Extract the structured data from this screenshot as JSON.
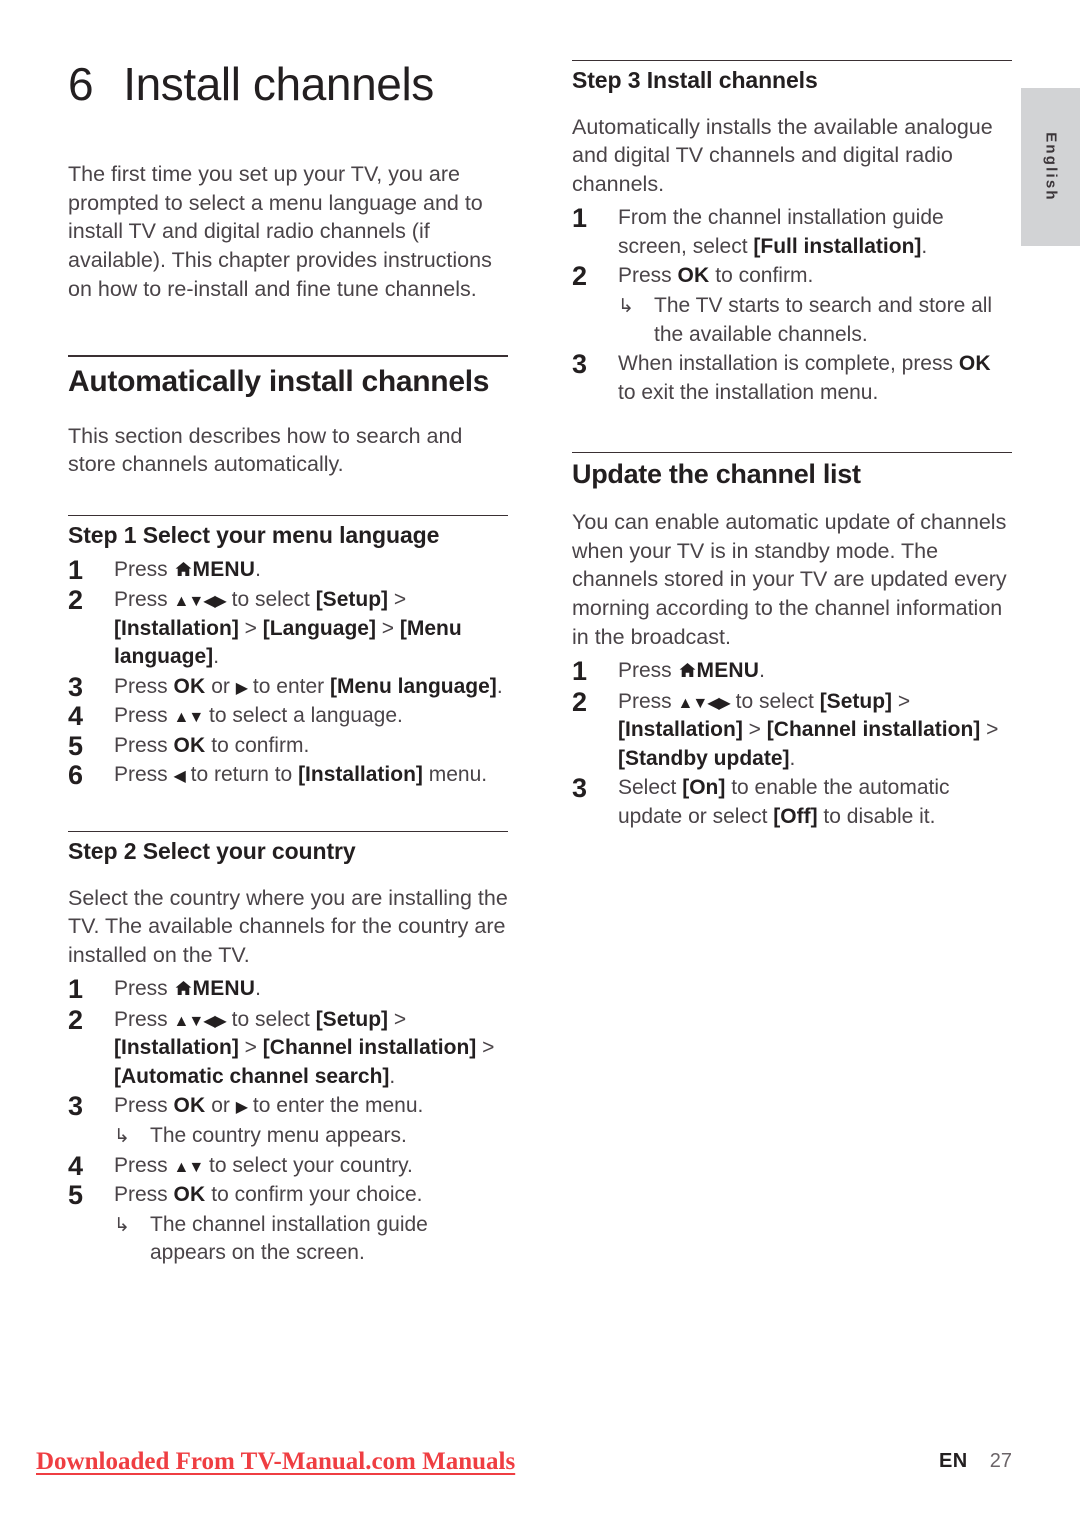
{
  "side_tab": {
    "label": "English"
  },
  "chapter": {
    "number": "6",
    "title": "Install channels"
  },
  "intro": "The first time you set up your TV, you are prompted to select a menu language and to install TV and digital radio channels (if available). This chapter provides instructions on how to re-install and fine tune channels.",
  "sections": {
    "auto_install": {
      "heading": "Automatically install channels",
      "body": "This section describes how to search and store channels automatically."
    },
    "step1": {
      "heading": "Step 1 Select your menu language",
      "items": [
        {
          "num": "1",
          "pre": "Press ",
          "icon": "home-icon",
          "key": "MENU",
          "post": "."
        },
        {
          "num": "2",
          "pre": "Press ",
          "glyph": "▲▼◀▶",
          "mid": " to select ",
          "menu1": "[Setup]",
          "sep1": " > ",
          "menu2": "[Installation]",
          "sep2": " > ",
          "menu3": "[Language]",
          "sep3": " > ",
          "menu4": "[Menu language]",
          "post": "."
        },
        {
          "num": "3",
          "pre": "Press ",
          "key": "OK",
          "mid": " or ",
          "glyph": "▶",
          "mid2": " to enter ",
          "menu1": "[Menu language]",
          "post": "."
        },
        {
          "num": "4",
          "pre": "Press ",
          "glyph": "▲▼",
          "mid": " to select a language.",
          "post": ""
        },
        {
          "num": "5",
          "pre": "Press ",
          "key": "OK",
          "mid": " to confirm.",
          "post": ""
        },
        {
          "num": "6",
          "pre": "Press ",
          "glyph": "◀",
          "mid": " to return to ",
          "menu1": "[Installation]",
          "post": " menu."
        }
      ]
    },
    "step2": {
      "heading": "Step 2 Select your country",
      "body": "Select the country where you are installing the TV. The available channels for the country are installed on the TV.",
      "items": [
        {
          "num": "1",
          "pre": "Press ",
          "icon": "home-icon",
          "key": "MENU",
          "post": "."
        },
        {
          "num": "2",
          "pre": "Press ",
          "glyph": "▲▼◀▶",
          "mid": " to select ",
          "menu1": "[Setup]",
          "sep1": " > ",
          "menu2": "[Installation]",
          "sep2": " > ",
          "menu3": "[Channel installation]",
          "sep3": " > ",
          "menu4": "[Automatic channel search]",
          "post": "."
        },
        {
          "num": "3",
          "pre": "Press ",
          "key": "OK",
          "mid": " or ",
          "glyph": "▶",
          "mid2": " to enter the menu.",
          "sub": "The country menu appears."
        },
        {
          "num": "4",
          "pre": "Press ",
          "glyph": "▲▼",
          "mid": " to select your country.",
          "post": ""
        },
        {
          "num": "5",
          "pre": "Press ",
          "key": "OK",
          "mid": " to confirm your choice.",
          "sub": "The channel installation guide appears on the screen."
        }
      ]
    },
    "step3": {
      "heading": "Step 3 Install channels",
      "body": "Automatically installs the available analogue and digital TV channels and digital radio channels.",
      "items": [
        {
          "num": "1",
          "pre": "From the channel installation guide screen, select ",
          "menu1": "[Full installation]",
          "post": "."
        },
        {
          "num": "2",
          "pre": "Press ",
          "key": "OK",
          "mid": " to confirm.",
          "sub": "The TV starts to search and store all the available channels."
        },
        {
          "num": "3",
          "pre": "When installation is complete, press ",
          "key": "OK",
          "mid": " to exit the installation menu.",
          "post": ""
        }
      ]
    },
    "update_list": {
      "heading": "Update the channel list",
      "body": "You can enable automatic update of channels when your TV is in standby mode. The channels stored in your TV are updated every morning according to the channel information in the broadcast.",
      "items": [
        {
          "num": "1",
          "pre": "Press ",
          "icon": "home-icon",
          "key": "MENU",
          "post": "."
        },
        {
          "num": "2",
          "pre": "Press ",
          "glyph": "▲▼◀▶",
          "mid": " to select ",
          "menu1": "[Setup]",
          "sep1": " > ",
          "menu2": "[Installation]",
          "sep2": " > ",
          "menu3": "[Channel installation]",
          "sep3": " > ",
          "menu4": "[Standby update]",
          "post": "."
        },
        {
          "num": "3",
          "pre": "Select ",
          "menu1": "[On]",
          "mid": " to enable the automatic update or select ",
          "menu2": "[Off]",
          "post": " to disable it."
        }
      ]
    }
  },
  "footer": {
    "watermark": "Downloaded From TV-Manual.com Manuals",
    "locale": "EN",
    "page": "27"
  },
  "colors": {
    "watermark_red": "#ef3e42",
    "tab_gray": "#d2d3d5",
    "heading_black": "#231f20",
    "body_gray": "#4a4448"
  }
}
